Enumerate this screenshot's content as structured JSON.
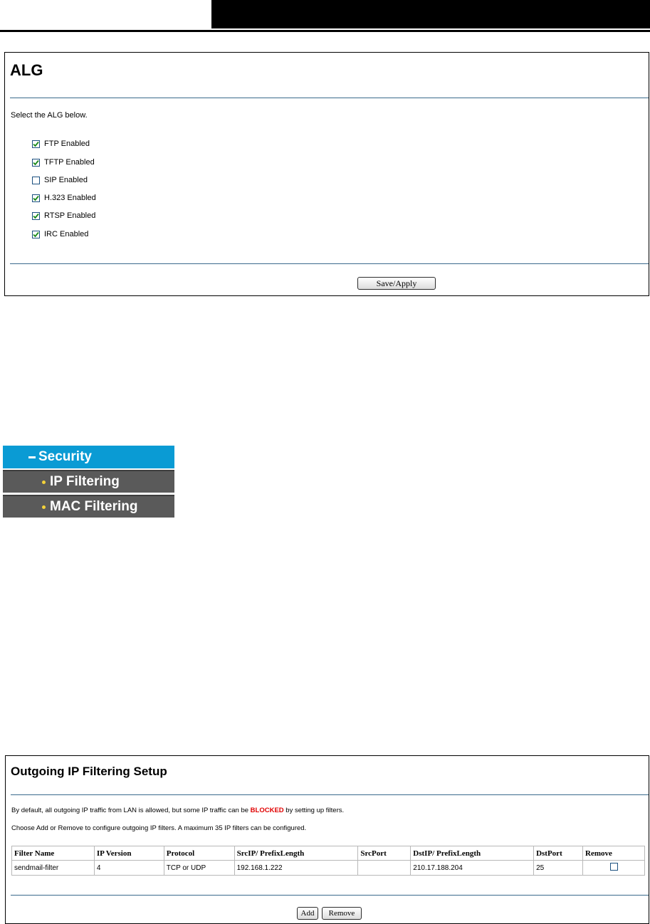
{
  "alg": {
    "title": "ALG",
    "instruction": "Select the ALG below.",
    "options": [
      {
        "label": "FTP Enabled",
        "checked": true
      },
      {
        "label": "TFTP Enabled",
        "checked": true
      },
      {
        "label": "SIP Enabled",
        "checked": false
      },
      {
        "label": "H.323 Enabled",
        "checked": true
      },
      {
        "label": "RTSP Enabled",
        "checked": true
      },
      {
        "label": "IRC Enabled",
        "checked": true
      }
    ],
    "save_label": "Save/Apply"
  },
  "menu": {
    "section": "Security",
    "items": [
      "IP Filtering",
      "MAC Filtering"
    ]
  },
  "ip_filtering": {
    "title": "Outgoing IP Filtering Setup",
    "desc_pre": "By default, all outgoing IP traffic from LAN is allowed, but some IP traffic can be ",
    "desc_blocked": "BLOCKED",
    "desc_post": " by setting up filters.",
    "desc2": "Choose Add or Remove to configure outgoing IP filters. A maximum 35 IP filters can be configured.",
    "columns": [
      "Filter Name",
      "IP Version",
      "Protocol",
      "SrcIP/ PrefixLength",
      "SrcPort",
      "DstIP/ PrefixLength",
      "DstPort",
      "Remove"
    ],
    "rows": [
      {
        "filter_name": "sendmail-filter",
        "ip_version": "4",
        "protocol": "TCP or UDP",
        "src_ip": "192.168.1.222",
        "src_port": "",
        "dst_ip": "210.17.188.204",
        "dst_port": "25",
        "remove": false
      }
    ],
    "add_label": "Add",
    "remove_label": "Remove"
  },
  "colors": {
    "menu_active": "#0a9bd4",
    "menu_item": "#5a5a5a",
    "rule": "#3a6a8c",
    "blocked": "#e00000"
  }
}
